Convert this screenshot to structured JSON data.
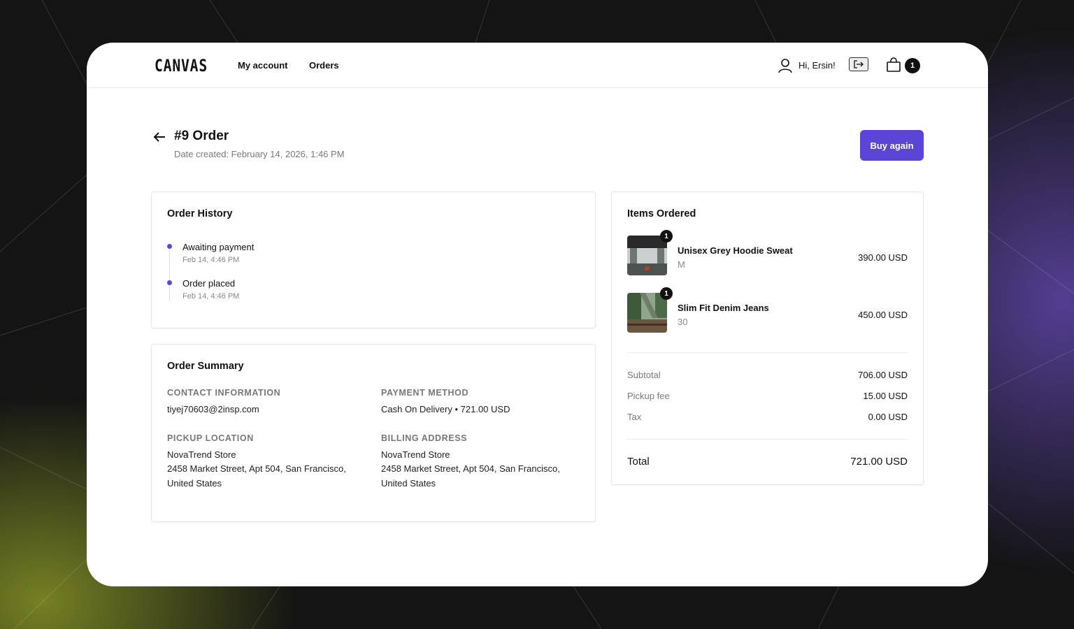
{
  "header": {
    "logo": "CANVAS",
    "nav": [
      "My account",
      "Orders"
    ],
    "greeting": "Hi, Ersin!",
    "cart_count": "1"
  },
  "page": {
    "title": "#9 Order",
    "date_created": "Date created: February 14, 2026, 1:46 PM",
    "buy_again": "Buy again"
  },
  "order_history": {
    "title": "Order History",
    "events": [
      {
        "label": "Awaiting payment",
        "time": "Feb 14, 4:46 PM"
      },
      {
        "label": "Order placed",
        "time": "Feb 14, 4:46 PM"
      }
    ]
  },
  "order_summary": {
    "title": "Order Summary",
    "contact_heading": "CONTACT INFORMATION",
    "contact_email": "tiyej70603@2insp.com",
    "payment_heading": "PAYMENT METHOD",
    "payment_value": "Cash On Delivery • 721.00 USD",
    "pickup_heading": "PICKUP LOCATION",
    "pickup_name": "NovaTrend Store",
    "pickup_address_1": "2458 Market Street, Apt 504, San Francisco,",
    "pickup_address_2": "United States",
    "billing_heading": "BILLING ADDRESS",
    "billing_name": "NovaTrend Store",
    "billing_address_1": "2458 Market Street, Apt 504, San Francisco,",
    "billing_address_2": "United States"
  },
  "items_ordered": {
    "title": "Items Ordered",
    "items": [
      {
        "name": "Unisex Grey Hoodie Sweat",
        "variant": "M",
        "qty": "1",
        "price": "390.00 USD"
      },
      {
        "name": "Slim Fit Denim Jeans",
        "variant": "30",
        "qty": "1",
        "price": "450.00 USD"
      }
    ],
    "subtotal_label": "Subtotal",
    "subtotal_value": "706.00 USD",
    "pickup_fee_label": "Pickup fee",
    "pickup_fee_value": "15.00 USD",
    "tax_label": "Tax",
    "tax_value": "0.00 USD",
    "total_label": "Total",
    "total_value": "721.00 USD"
  },
  "colors": {
    "accent": "#5b45d6",
    "background": "#141414"
  }
}
